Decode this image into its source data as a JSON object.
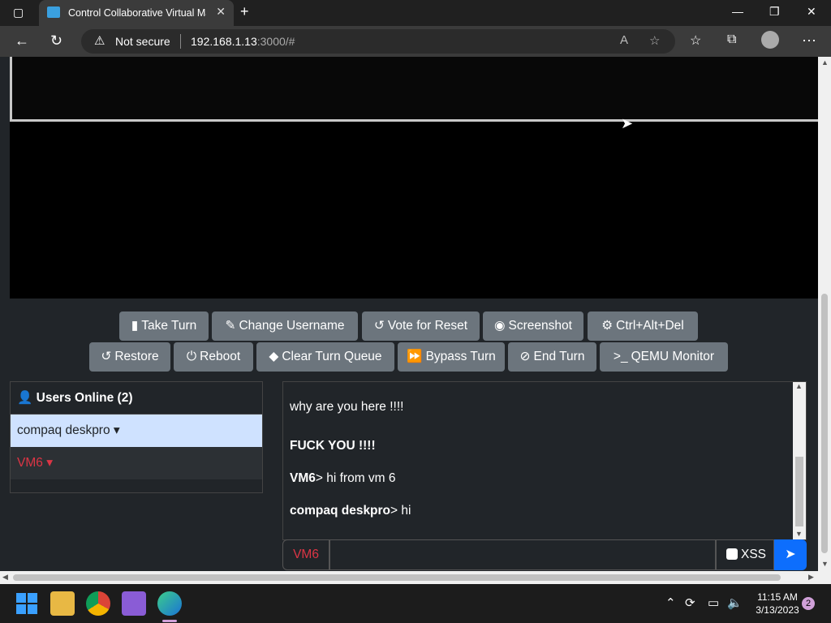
{
  "browser": {
    "tab_title": "Control Collaborative Virtual Mac",
    "address_warning": "Not secure",
    "url_host": "192.168.1.13",
    "url_rest": ":3000/#"
  },
  "toolbar": {
    "row1": [
      {
        "icon": "trash-icon",
        "glyph": "▮",
        "label": "Take Turn"
      },
      {
        "icon": "user-edit-icon",
        "glyph": "✎",
        "label": "Change Username"
      },
      {
        "icon": "undo-icon",
        "glyph": "↺",
        "label": "Vote for Reset"
      },
      {
        "icon": "camera-icon",
        "glyph": "◉",
        "label": "Screenshot"
      },
      {
        "icon": "gear-icon",
        "glyph": "⚙",
        "label": "Ctrl+Alt+Del"
      }
    ],
    "row2": [
      {
        "icon": "undo-icon",
        "glyph": "↺",
        "label": "Restore"
      },
      {
        "icon": "power-icon",
        "glyph": "⏻",
        "label": "Reboot"
      },
      {
        "icon": "eraser-icon",
        "glyph": "◆",
        "label": "Clear Turn Queue"
      },
      {
        "icon": "fast-forward-icon",
        "glyph": "⏩",
        "label": "Bypass Turn"
      },
      {
        "icon": "ban-icon",
        "glyph": "⊘",
        "label": "End Turn"
      },
      {
        "icon": "terminal-icon",
        "glyph": ">_",
        "label": "QEMU Monitor"
      }
    ]
  },
  "users": {
    "heading": "Users Online (2)",
    "list": [
      {
        "name": "compaq deskpro",
        "caret": "▾"
      },
      {
        "name": "VM6",
        "caret": "▾"
      }
    ]
  },
  "chat": {
    "messages": [
      {
        "user": "",
        "text": "why are you here !!!!"
      },
      {
        "user": "",
        "text": "FUCK YOU !!!!",
        "bold": true
      },
      {
        "user": "VM6",
        "text": "> hi from vm 6"
      },
      {
        "user": "compaq deskpro",
        "text": "> hi"
      }
    ],
    "username_label": "VM6",
    "input_value": "",
    "xss_label": "XSS"
  },
  "taskbar": {
    "time": "11:15 AM",
    "date": "3/13/2023",
    "notifications": "2"
  },
  "colors": {
    "button": "#6c757d",
    "selected_user": "#cfe2ff",
    "danger": "#dc3545",
    "primary": "#0d6efd"
  }
}
